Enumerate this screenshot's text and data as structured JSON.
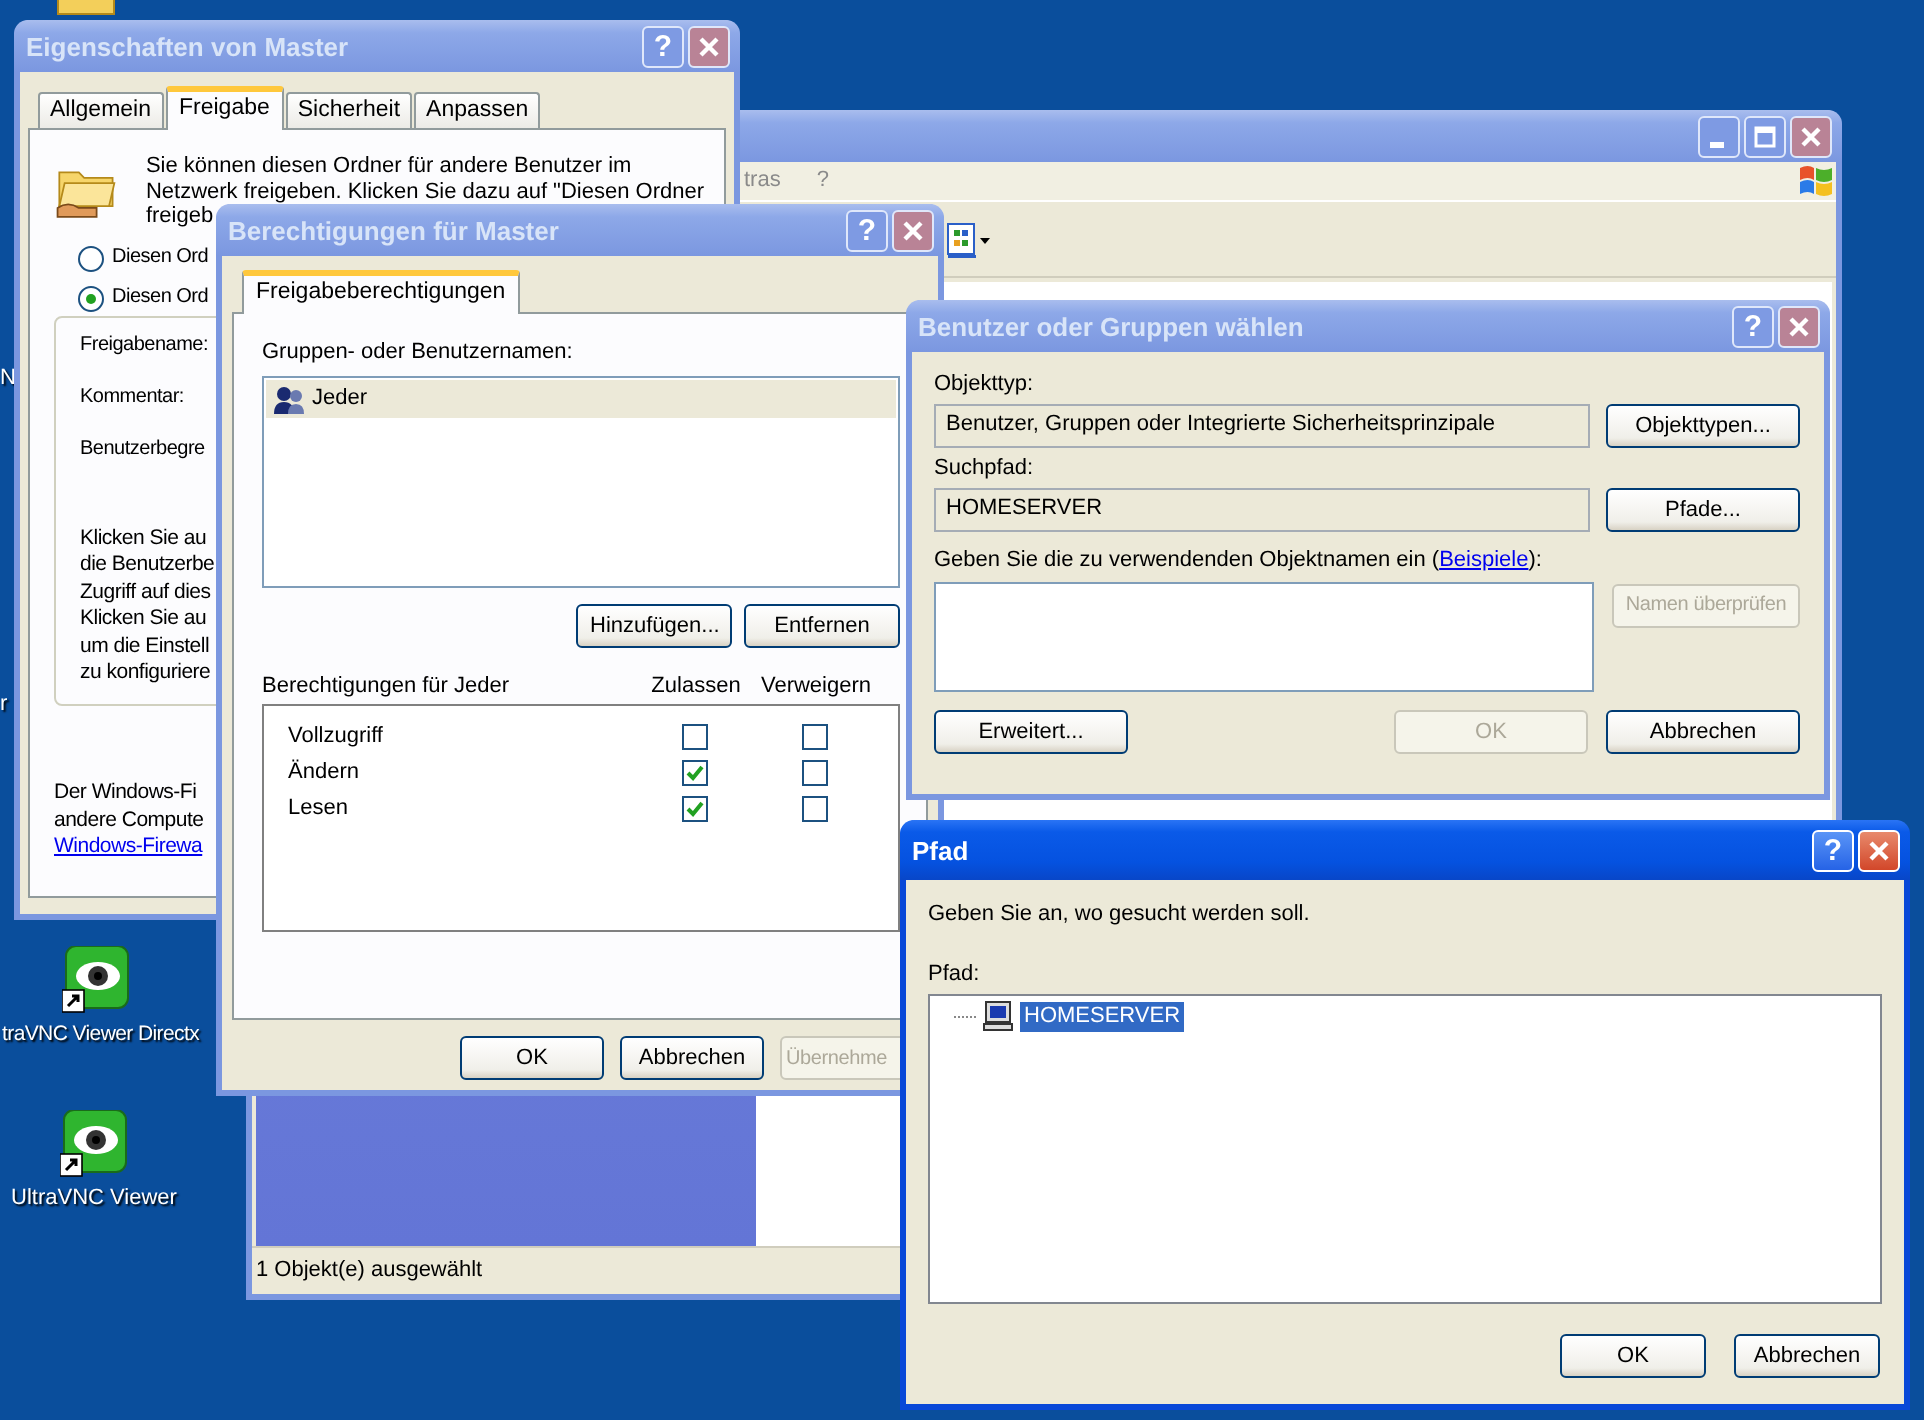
{
  "desktop": {
    "icons": [
      {
        "label": "traVNC Viewer Directx"
      },
      {
        "label": "UltraVNC Viewer"
      }
    ],
    "fragments": [
      "N",
      "r"
    ]
  },
  "explorer": {
    "active": false,
    "menu": [
      "tras",
      "?"
    ],
    "status_bar": "1 Objekt(e) ausgewählt"
  },
  "properties": {
    "title": "Eigenschaften von Master",
    "active": false,
    "help": "?",
    "tabs": [
      {
        "label": "Allgemein",
        "selected": false
      },
      {
        "label": "Freigabe",
        "selected": true
      },
      {
        "label": "Sicherheit",
        "selected": false
      },
      {
        "label": "Anpassen",
        "selected": false
      }
    ],
    "intro": "Sie können diesen Ordner für andere Benutzer im\nNetzwerk freigeben. Klicken Sie dazu auf \"Diesen Ordner\nfreigeb",
    "options": [
      {
        "label": "Diesen Ord",
        "selected": false
      },
      {
        "label": "Diesen Ord",
        "selected": true
      }
    ],
    "fields": [
      "Freigabename:",
      "Kommentar:",
      "Benutzerbegre"
    ],
    "info": "Klicken Sie au\ndie Benutzerbe\nZugriff auf dies\nKlicken Sie au\num die Einstell\nzu konfiguriere",
    "firewall_text": "Der Windows-Fi\nandere Compute",
    "firewall_link": "Windows-Firewa"
  },
  "permissions": {
    "title": "Berechtigungen für Master",
    "active": false,
    "help": "?",
    "tabs": [
      {
        "label": "Freigabeberechtigungen",
        "selected": true
      }
    ],
    "names_label": "Gruppen- oder Benutzernamen:",
    "names": [
      {
        "label": "Jeder",
        "selected": true
      }
    ],
    "name_buttons": [
      "Hinzufügen...",
      "Entfernen"
    ],
    "perm_label": "Berechtigungen für Jeder",
    "columns": [
      "Zulassen",
      "Verweigern"
    ],
    "rows": [
      {
        "label": "Vollzugriff",
        "allow": false,
        "deny": false
      },
      {
        "label": "Ändern",
        "allow": true,
        "deny": false
      },
      {
        "label": "Lesen",
        "allow": true,
        "deny": false
      }
    ],
    "buttons": [
      {
        "label": "OK",
        "disabled": false
      },
      {
        "label": "Abbrechen",
        "disabled": false
      },
      {
        "label": "Übernehme",
        "disabled": true
      }
    ]
  },
  "select_users": {
    "title": "Benutzer oder Gruppen wählen",
    "active": false,
    "help": "?",
    "object_type_label": "Objekttyp:",
    "object_type": "Benutzer, Gruppen oder Integrierte Sicherheitsprinzipale",
    "object_type_button": "Objekttypen...",
    "search_path_label": "Suchpfad:",
    "search_path": "HOMESERVER",
    "paths_button": "Pfade...",
    "names_prompt": "Geben Sie die zu verwendenden Objektnamen ein (",
    "names_link": "Beispiele",
    "names_prompt_end": "):",
    "check_button": {
      "label": "Namen überprüfen",
      "disabled": true
    },
    "buttons": [
      {
        "label": "Erweitert...",
        "disabled": false
      },
      {
        "label": "OK",
        "disabled": true
      },
      {
        "label": "Abbrechen",
        "disabled": false
      }
    ]
  },
  "path_dialog": {
    "title": "Pfad",
    "active": true,
    "help": "?",
    "prompt": "Geben Sie an, wo gesucht werden soll.",
    "path_label": "Pfad:",
    "tree": [
      {
        "label": "HOMESERVER",
        "selected": true
      }
    ],
    "buttons": [
      {
        "label": "OK",
        "disabled": false
      },
      {
        "label": "Abbrechen",
        "disabled": false
      }
    ]
  }
}
